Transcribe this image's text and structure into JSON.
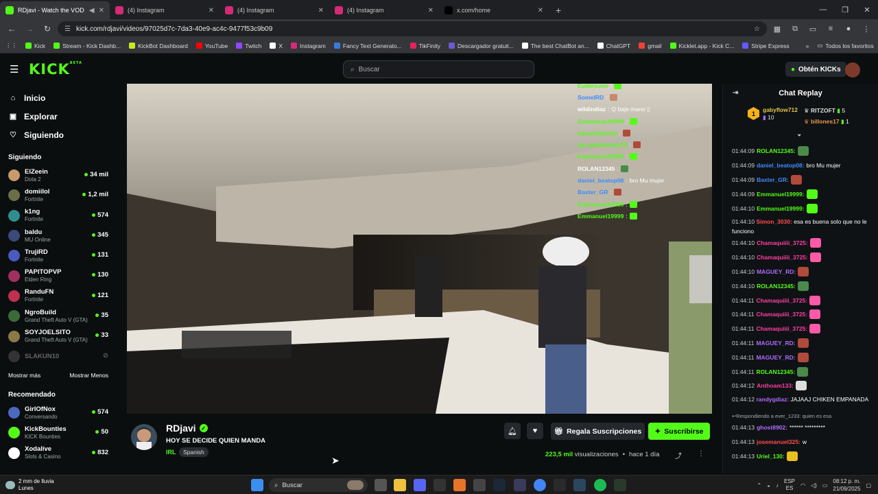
{
  "browser": {
    "tabs": [
      {
        "title": "RDjavi - Watch the VOD on",
        "fav": "#53fc18",
        "active": true
      },
      {
        "title": "(4) Instagram",
        "fav": "#d62976",
        "active": false
      },
      {
        "title": "(4) Instagram",
        "fav": "#d62976",
        "active": false
      },
      {
        "title": "(4) Instagram",
        "fav": "#d62976",
        "active": false
      },
      {
        "title": "x.com/home",
        "fav": "#000000",
        "active": false
      }
    ],
    "url": "kick.com/rdjavi/videos/97025d7c-7da3-40e9-ac4c-9477f53c9b09",
    "bookmarks": [
      {
        "label": "Kick",
        "color": "#53fc18"
      },
      {
        "label": "Stream - Kick Dashb...",
        "color": "#53fc18"
      },
      {
        "label": "KickBot Dashboard",
        "color": "#c8e820"
      },
      {
        "label": "YouTube",
        "color": "#ff0000"
      },
      {
        "label": "Twitch",
        "color": "#9146ff"
      },
      {
        "label": "X",
        "color": "#ffffff"
      },
      {
        "label": "Instagram",
        "color": "#d62976"
      },
      {
        "label": "Fancy Text Generato...",
        "color": "#3a7bd5"
      },
      {
        "label": "TikFinity",
        "color": "#e0245e"
      },
      {
        "label": "Descargador gratuit...",
        "color": "#6a5acd"
      },
      {
        "label": "The best ChatBot an...",
        "color": "#ffffff"
      },
      {
        "label": "ChatGPT",
        "color": "#ffffff"
      },
      {
        "label": "gmail",
        "color": "#ea4335"
      },
      {
        "label": "Kicklet.app - Kick C...",
        "color": "#53fc18"
      },
      {
        "label": "Stripe Express",
        "color": "#635bff"
      }
    ],
    "all_bookmarks": "Todos los favoritos"
  },
  "kick": {
    "logo": "KICK",
    "logo_sup": "BETA",
    "search_placeholder": "Buscar",
    "kicks_button": "Obtén KICKs"
  },
  "sidebar": {
    "nav": [
      {
        "label": "Inicio",
        "icon": "home-icon",
        "glyph": "⌂"
      },
      {
        "label": "Explorar",
        "icon": "compass-icon",
        "glyph": "▣"
      },
      {
        "label": "Siguiendo",
        "icon": "heart-icon",
        "glyph": "♡"
      }
    ],
    "following_title": "Siguiendo",
    "following": [
      {
        "name": "ElZeein",
        "cat": "Dota 2",
        "viewers": "34 mil",
        "color": "#c89a6a"
      },
      {
        "name": "domiilol",
        "cat": "Fortnite",
        "viewers": "1,2 mil",
        "color": "#6b6e4a"
      },
      {
        "name": "k1ng",
        "cat": "Fortnite",
        "viewers": "574",
        "color": "#2f8f8f"
      },
      {
        "name": "baldu",
        "cat": "MU Online",
        "viewers": "345",
        "color": "#3a4a7a"
      },
      {
        "name": "TrujiRD",
        "cat": "Fortnite",
        "viewers": "131",
        "color": "#4a5ac0"
      },
      {
        "name": "PAPITOPVP",
        "cat": "Elden Ring",
        "viewers": "130",
        "color": "#a03060"
      },
      {
        "name": "RanduFN",
        "cat": "Fortnite",
        "viewers": "121",
        "color": "#c03050"
      },
      {
        "name": "NgroBuild",
        "cat": "Grand Theft Auto V (GTA)",
        "viewers": "35",
        "color": "#3a6a3a"
      },
      {
        "name": "SOYJOELSITO",
        "cat": "Grand Theft Auto V (GTA)",
        "viewers": "33",
        "color": "#8a7a4a"
      }
    ],
    "offline": "SLAKUN10",
    "show_more": "Mostrar más",
    "show_less": "Mostrar Menos",
    "recommended_title": "Recomendado",
    "recommended": [
      {
        "name": "GirlOfNox",
        "cat": "Conversando",
        "viewers": "574",
        "color": "#4a6ac0"
      },
      {
        "name": "KickBounties",
        "cat": "KICK Bounties",
        "viewers": "50",
        "color": "#53fc18"
      },
      {
        "name": "Xodalive",
        "cat": "Slots & Casino",
        "viewers": "832",
        "color": "#ffffff"
      }
    ]
  },
  "overlay_chat": [
    {
      "user": "Eudersonn",
      "color": "#53fc18",
      "msg": "",
      "emote": "#53fc18"
    },
    {
      "user": "SomeIRD",
      "color": "#3d8bff",
      "msg": "",
      "emote": "#c88a6a"
    },
    {
      "user": "wildindiaz",
      "color": "#ffffff",
      "msg": "Q baje mano ▯",
      "emote": ""
    },
    {
      "user": "Emmanuel19999",
      "color": "#53fc18",
      "msg": "",
      "emote": "#53fc18"
    },
    {
      "user": "eduardopintoj",
      "color": "#53fc18",
      "msg": "",
      "emote": "#b04a3a"
    },
    {
      "user": "muzankibutsuji10",
      "color": "#53fc18",
      "msg": "",
      "emote": "#b04a3a"
    },
    {
      "user": "Emmanuel19999",
      "color": "#53fc18",
      "msg": "",
      "emote": "#53fc18"
    },
    {
      "user": "ROLAN12345",
      "color": "#ffffff",
      "msg": "",
      "emote": "#4a8a4a"
    },
    {
      "user": "daniel_beatop08",
      "color": "#3d8bff",
      "msg": "bro Mu mujer",
      "emote": ""
    },
    {
      "user": "Baxter_GR",
      "color": "#3d8bff",
      "msg": "",
      "emote": "#b04a3a"
    },
    {
      "user": "Emmanuel19999",
      "color": "#53fc18",
      "msg": "",
      "emote": "#53fc18"
    },
    {
      "user": "Emmanuel19999",
      "color": "#53fc18",
      "msg": "",
      "emote": "#53fc18"
    }
  ],
  "stream": {
    "channel": "RDjavi",
    "title": "HOY SE DECIDE QUIEN MANDA",
    "category": "IRL",
    "tag": "Spanish",
    "gift_label": "Regala Suscripciones",
    "sub_label": "Suscribirse",
    "views_num": "223,5 mil",
    "views_label": "visualizaciones",
    "ago": "hace 1 día"
  },
  "chat": {
    "header": "Chat Replay",
    "leaders": [
      {
        "name": "gabyflow712",
        "count": "10"
      },
      {
        "name": "RITZOFT",
        "count": "5"
      },
      {
        "name": "billones17",
        "count": "1"
      }
    ],
    "leader_rank": "1",
    "lines": [
      {
        "ts": "01:44:09",
        "user": "ROLAN12345:",
        "color": "#53fc18",
        "msg": "",
        "emote": "#4a8a4a"
      },
      {
        "ts": "01:44:09",
        "user": "daniel_beatop08:",
        "color": "#3d8bff",
        "msg": "bro Mu mujer",
        "emote": ""
      },
      {
        "ts": "01:44:09",
        "user": "Baxter_GR:",
        "color": "#3d8bff",
        "msg": "",
        "emote": "#b04a3a"
      },
      {
        "ts": "01:44:09",
        "user": "Emmanuel19999:",
        "color": "#53fc18",
        "msg": "",
        "emote": "#53fc18"
      },
      {
        "ts": "01:44:10",
        "user": "Emmanuel19999:",
        "color": "#53fc18",
        "msg": "",
        "emote": "#53fc18"
      },
      {
        "ts": "01:44:10",
        "user": "Simon_3030:",
        "color": "#ff4d4d",
        "msg": "esa es buena solo que no le funciono",
        "emote": "",
        "wrap": true
      },
      {
        "ts": "01:44:10",
        "user": "Chamaquiiii_3725:",
        "color": "#ff3ea5",
        "msg": "",
        "emote": "#ff5aa8"
      },
      {
        "ts": "01:44:10",
        "user": "Chamaquiiii_3725:",
        "color": "#ff3ea5",
        "msg": "",
        "emote": "#ff5aa8"
      },
      {
        "ts": "01:44:10",
        "user": "MAGUEY_RD:",
        "color": "#b06aff",
        "msg": "",
        "emote": "#b04a3a"
      },
      {
        "ts": "01:44:10",
        "user": "ROLAN12345:",
        "color": "#53fc18",
        "msg": "",
        "emote": "#4a8a4a"
      },
      {
        "ts": "01:44:11",
        "user": "Chamaquiiii_3725:",
        "color": "#ff3ea5",
        "msg": "",
        "emote": "#ff5aa8"
      },
      {
        "ts": "01:44:11",
        "user": "Chamaquiiii_3725:",
        "color": "#ff3ea5",
        "msg": "",
        "emote": "#ff5aa8"
      },
      {
        "ts": "01:44:11",
        "user": "Chamaquiiii_3725:",
        "color": "#ff3ea5",
        "msg": "",
        "emote": "#ff5aa8"
      },
      {
        "ts": "01:44:11",
        "user": "MAGUEY_RD:",
        "color": "#b06aff",
        "msg": "",
        "emote": "#b04a3a"
      },
      {
        "ts": "01:44:11",
        "user": "MAGUEY_RD:",
        "color": "#b06aff",
        "msg": "",
        "emote": "#b04a3a"
      },
      {
        "ts": "01:44:11",
        "user": "ROLAN12345:",
        "color": "#53fc18",
        "msg": "",
        "emote": "#4a8a4a"
      },
      {
        "ts": "01:44:12",
        "user": "Anthoam133:",
        "color": "#ff3ea5",
        "msg": "",
        "emote": "#dddddd"
      },
      {
        "ts": "01:44:12",
        "user": "randygdiaz:",
        "color": "#b06aff",
        "msg": "JAJAAJ CHIKEN EMPANADA",
        "emote": "",
        "wrap": true
      },
      {
        "reply": "Respondiendo a ever_1233: quien es esa"
      },
      {
        "ts": "01:44:13",
        "user": "ghost8902:",
        "color": "#b06aff",
        "msg": "****** *********",
        "emote": ""
      },
      {
        "ts": "01:44:13",
        "user": "josemanuel325:",
        "color": "#ff4d4d",
        "msg": "w",
        "emote": ""
      },
      {
        "ts": "01:44:13",
        "user": "Uriel_130:",
        "color": "#53fc18",
        "msg": "",
        "emote": "#e8c020"
      }
    ]
  },
  "taskbar": {
    "weather_line1": "2 mm de lluvia",
    "weather_line2": "Lunes",
    "search": "Buscar",
    "lang1": "ESP",
    "lang2": "ES",
    "time": "08:12 p. m.",
    "date": "21/09/2025"
  }
}
